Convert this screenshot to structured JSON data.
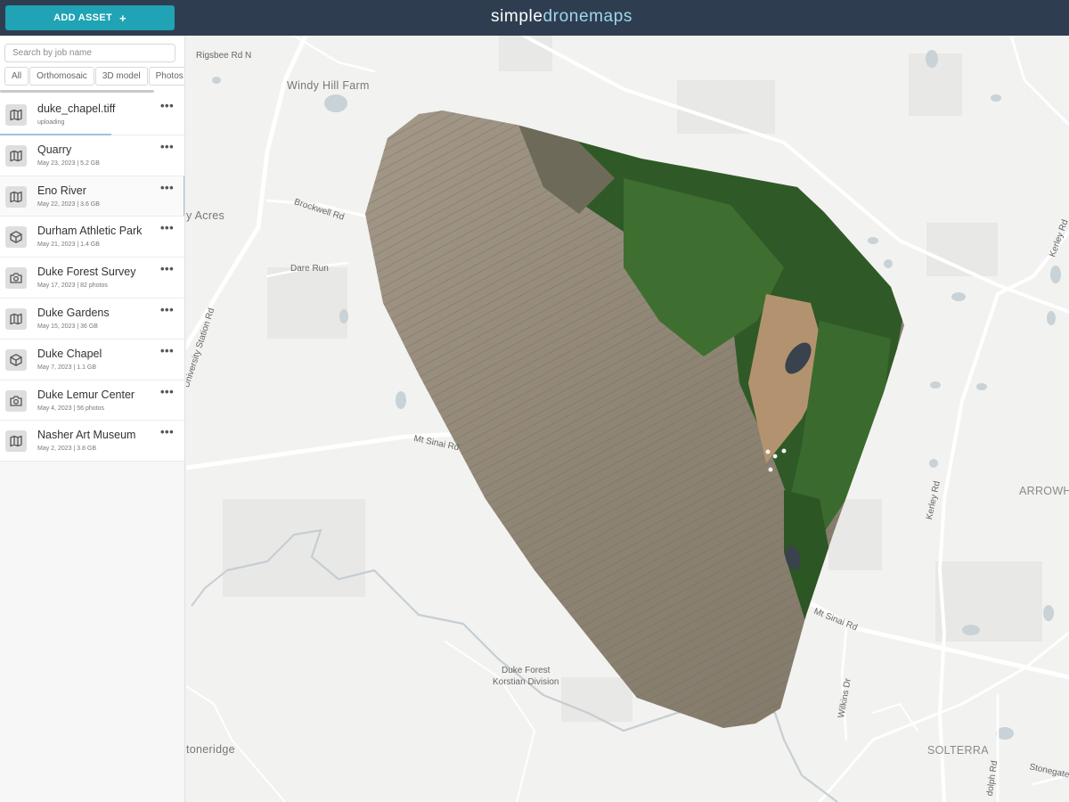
{
  "header": {
    "add_asset_label": "ADD ASSET",
    "add_icon": "+",
    "brand_part1": "simple",
    "brand_part2": "dronemaps"
  },
  "sidebar": {
    "search_placeholder": "Search by job name",
    "filters": [
      "All",
      "Orthomosaic",
      "3D model",
      "Photos"
    ],
    "items": [
      {
        "name": "duke_chapel.tiff",
        "meta": "uploading",
        "icon": "map-icon",
        "upload_progress": 0.6
      },
      {
        "name": "Quarry",
        "meta": "May 23, 2023 | 5.2 GB",
        "icon": "map-icon"
      },
      {
        "name": "Eno River",
        "meta": "May 22, 2023 | 3.6 GB",
        "icon": "map-icon"
      },
      {
        "name": "Durham Athletic Park",
        "meta": "May 21, 2023 | 1.4 GB",
        "icon": "cube-icon"
      },
      {
        "name": "Duke Forest Survey",
        "meta": "May 17, 2023 | 82 photos",
        "icon": "camera-icon"
      },
      {
        "name": "Duke Gardens",
        "meta": "May 15, 2023 | 36 GB",
        "icon": "map-icon"
      },
      {
        "name": "Duke Chapel",
        "meta": "May 7, 2023 | 1.1 GB",
        "icon": "cube-icon"
      },
      {
        "name": "Duke Lemur Center",
        "meta": "May 4, 2023 | 56 photos",
        "icon": "camera-icon"
      },
      {
        "name": "Nasher Art Museum",
        "meta": "May 2, 2023 | 3.8 GB",
        "icon": "map-icon"
      }
    ],
    "more_icon": "•••"
  },
  "map": {
    "labels": {
      "rigsbee": "Rigsbee Rd N",
      "windy_hill": "Windy Hill Farm",
      "acres": "y Acres",
      "brockwell": "Brockwell Rd",
      "dare_run": "Dare Run",
      "university_station": "University Station Rd",
      "mt_sinai_1": "Mt Sinai Rd",
      "mt_sinai_2": "Mt Sinai Rd",
      "duke_forest": "Duke Forest",
      "korstian": "Korstian Division",
      "stoneridge": "toneridge",
      "kerley_1": "Kerley Rd",
      "kerley_2": "Kerley Rd",
      "arrowhe": "ARROWHE",
      "wilkins": "Wilkins Dr",
      "solterra": "SOLTERRA",
      "stonegate": "Stonegate D",
      "randolph": "dolph Rd"
    },
    "overlay_layer": "duke_chapel orthomosaic (aerial imagery)"
  }
}
